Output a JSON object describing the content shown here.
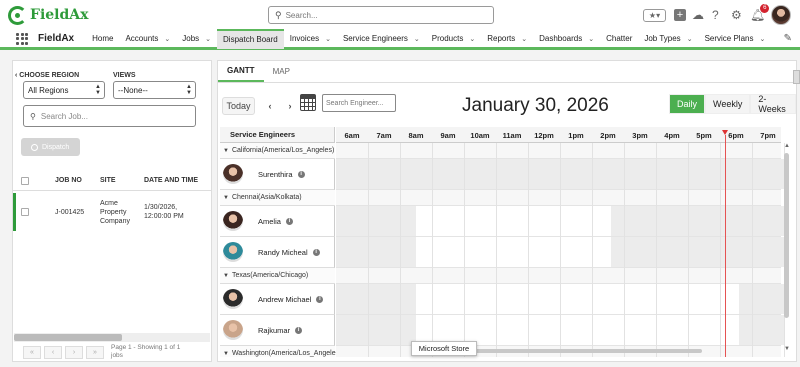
{
  "brand": {
    "name": "FieldAx",
    "accent": "#2e9b3a",
    "nav_accent": "#5cb85c"
  },
  "header": {
    "search_placeholder": "Search...",
    "icons": [
      "search-icon",
      "star-icon",
      "plus-icon",
      "cloud-icon",
      "help-icon",
      "gear-icon",
      "bell-icon",
      "avatar"
    ],
    "notification_count": "6"
  },
  "nav": {
    "app_name": "FieldAx",
    "items": [
      {
        "label": "Home",
        "has_menu": false,
        "active": false
      },
      {
        "label": "Accounts",
        "has_menu": true,
        "active": false
      },
      {
        "label": "Jobs",
        "has_menu": true,
        "active": false
      },
      {
        "label": "Dispatch Board",
        "has_menu": false,
        "active": true
      },
      {
        "label": "Invoices",
        "has_menu": true,
        "active": false
      },
      {
        "label": "Service Engineers",
        "has_menu": true,
        "active": false
      },
      {
        "label": "Products",
        "has_menu": true,
        "active": false
      },
      {
        "label": "Reports",
        "has_menu": true,
        "active": false
      },
      {
        "label": "Dashboards",
        "has_menu": true,
        "active": false
      },
      {
        "label": "Chatter",
        "has_menu": false,
        "active": false
      },
      {
        "label": "Job Types",
        "has_menu": true,
        "active": false
      },
      {
        "label": "Service Plans",
        "has_menu": true,
        "active": false
      }
    ]
  },
  "left": {
    "region_label": "Choose Region",
    "region_value": "All Regions",
    "views_label": "Views",
    "views_value": "--None--",
    "search_placeholder": "Search Job...",
    "dispatch_label": "Dispatch",
    "columns": [
      "JOB NO",
      "SITE",
      "DATE AND TIME"
    ],
    "jobs": [
      {
        "job_no": "J-001425",
        "site": "Acme Property Company",
        "datetime": "1/30/2026, 12:00:00 PM"
      }
    ],
    "pager_text": "Page 1 - Showing 1 of 1 jobs"
  },
  "right": {
    "tabs": [
      {
        "label": "GANTT",
        "active": true
      },
      {
        "label": "MAP",
        "active": false
      }
    ],
    "today_label": "Today",
    "prev_icon": "chevron-left-icon",
    "next_icon": "chevron-right-icon",
    "search_engineer_placeholder": "Search Engineer...",
    "date_title": "January 30, 2026",
    "views": [
      {
        "label": "Daily",
        "active": true
      },
      {
        "label": "Weekly",
        "active": false
      },
      {
        "label": "2-Weeks",
        "active": false
      }
    ],
    "engineers_header": "Service Engineers",
    "hours": [
      "6am",
      "7am",
      "8am",
      "9am",
      "10am",
      "11am",
      "12pm",
      "1pm",
      "2pm",
      "3pm",
      "4pm",
      "5pm",
      "6pm",
      "7pm"
    ],
    "current_hour_index": 12,
    "current_time_fraction": 0.15,
    "rows": [
      {
        "type": "group",
        "label": "California(America/Los_Angeles)"
      },
      {
        "type": "engineer",
        "name": "Surenthira",
        "avatar_color": "#4a3028"
      },
      {
        "type": "group",
        "label": "Chennai(Asia/Kolkata)"
      },
      {
        "type": "engineer",
        "name": "Amelia",
        "avatar_color": "#3a2520"
      },
      {
        "type": "engineer",
        "name": "Randy Micheal",
        "avatar_color": "#2e8a9a"
      },
      {
        "type": "group",
        "label": "Texas(America/Chicago)"
      },
      {
        "type": "engineer",
        "name": "Andrew Michael",
        "avatar_color": "#2b2b2b"
      },
      {
        "type": "engineer",
        "name": "Rajkumar",
        "avatar_color": "#c9a48a"
      },
      {
        "type": "group",
        "label": "Washington(America/Los_Angeles)"
      }
    ],
    "tooltip": "Microsoft Store"
  }
}
